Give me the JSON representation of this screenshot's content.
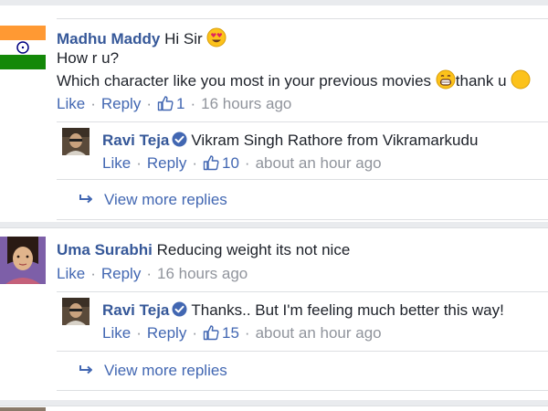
{
  "comments": [
    {
      "author": "Madhu Maddy",
      "text": "Hi Sir",
      "line2": "How r u?",
      "line3": "Which character like you most in your previous movies",
      "line3_tail": "thank u",
      "like_label": "Like",
      "reply_label": "Reply",
      "like_count": "1",
      "time": "16 hours ago",
      "avatar_icon": "india-flag-icon",
      "reply": {
        "author": "Ravi Teja",
        "text": "Vikram Singh Rathore from Vikramarkudu",
        "like_label": "Like",
        "reply_label": "Reply",
        "like_count": "10",
        "time": "about an hour ago"
      },
      "view_more": "View more replies"
    },
    {
      "author": "Uma Surabhi",
      "text": "Reducing weight its not nice",
      "like_label": "Like",
      "reply_label": "Reply",
      "time": "16 hours ago",
      "reply": {
        "author": "Ravi Teja",
        "text": "Thanks.. But I'm feeling much better this way!",
        "like_label": "Like",
        "reply_label": "Reply",
        "like_count": "15",
        "time": "about an hour ago"
      },
      "view_more": "View more replies"
    }
  ],
  "colors": {
    "link": "#365899",
    "action": "#4267b2",
    "muted": "#90949c",
    "divider": "#dddfe2",
    "verified": "#4267b2"
  }
}
